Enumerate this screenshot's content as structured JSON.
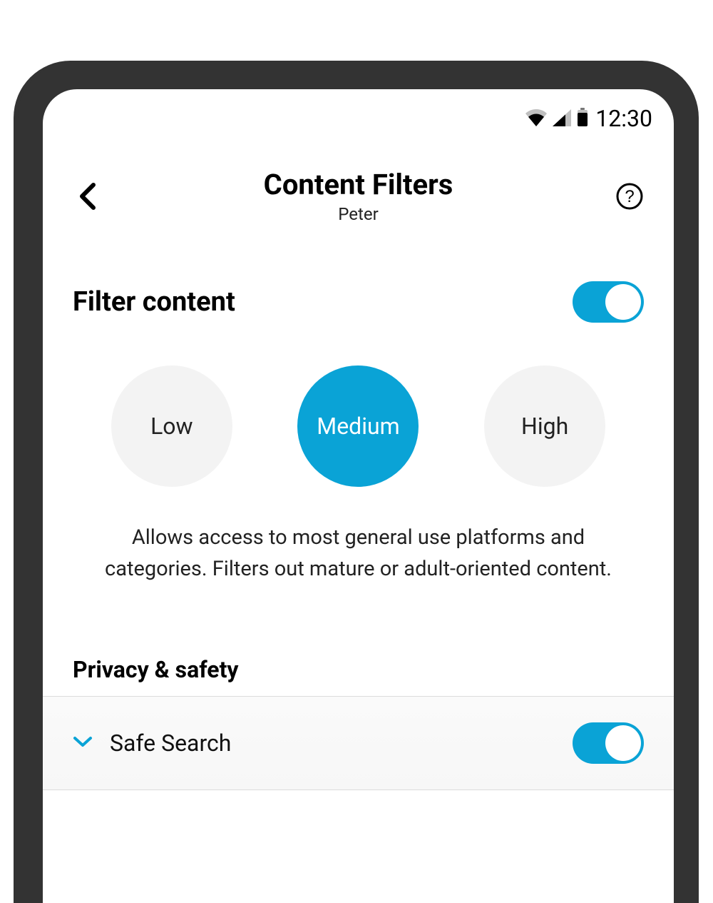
{
  "status_bar": {
    "time": "12:30"
  },
  "header": {
    "title": "Content Filters",
    "subtitle": "Peter"
  },
  "filter": {
    "title": "Filter content",
    "toggle_on": true,
    "levels": {
      "low": "Low",
      "medium": "Medium",
      "high": "High",
      "selected": "medium"
    },
    "description": "Allows access to most general use platforms and categories. Filters out mature or adult-oriented content."
  },
  "privacy": {
    "heading": "Privacy & safety",
    "items": [
      {
        "label": "Safe Search",
        "toggle_on": true
      }
    ]
  },
  "colors": {
    "accent": "#0aa3d6",
    "inactive_pill": "#f3f3f3"
  }
}
